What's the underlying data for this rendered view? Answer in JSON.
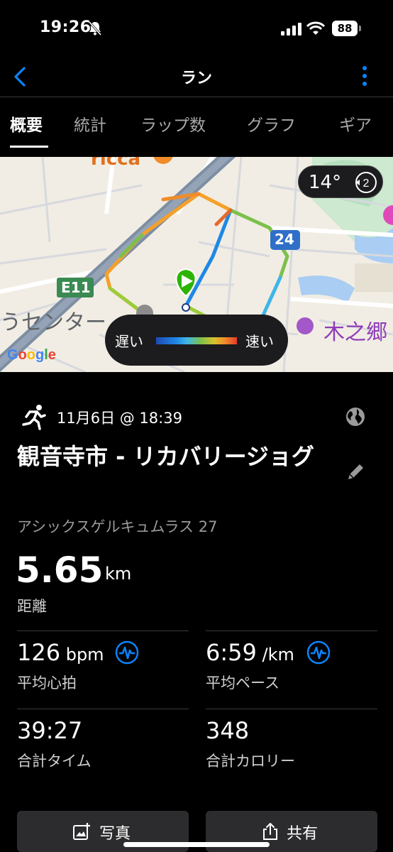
{
  "status_bar": {
    "time": "19:26",
    "battery": "88"
  },
  "nav": {
    "title": "ラン"
  },
  "tabs": [
    {
      "label": "概要"
    },
    {
      "label": "統計"
    },
    {
      "label": "ラップ数"
    },
    {
      "label": "グラフ"
    },
    {
      "label": "ギア"
    }
  ],
  "map": {
    "temperature": "14°",
    "wind": "2",
    "legend_slow": "遅い",
    "legend_fast": "速い",
    "labels": {
      "route_e11": "E11",
      "route_24": "24",
      "place_center": "うセンター",
      "place_top": "ricca",
      "place_right": "木之郷",
      "google": "Google"
    }
  },
  "activity": {
    "date": "11月6日 @ 18:39",
    "title": "観音寺市 - リカバリージョグ",
    "gear": "アシックスゲルキュムラス 27",
    "distance_value": "5.65",
    "distance_unit": "km",
    "distance_label": "距離"
  },
  "stats": [
    {
      "value": "126",
      "unit": " bpm",
      "label": "平均心拍"
    },
    {
      "value": "6:59",
      "unit": " /km",
      "label": "平均ペース"
    },
    {
      "value": "39:27",
      "unit": "",
      "label": "合計タイム"
    },
    {
      "value": "348",
      "unit": "",
      "label": "合計カロリー"
    }
  ],
  "buttons": {
    "photo": "写真",
    "share": "共有"
  },
  "colors": {
    "accent": "#0a84ff",
    "route_start": "#2db400",
    "background": "#000000",
    "button": "#2c2c2e"
  }
}
